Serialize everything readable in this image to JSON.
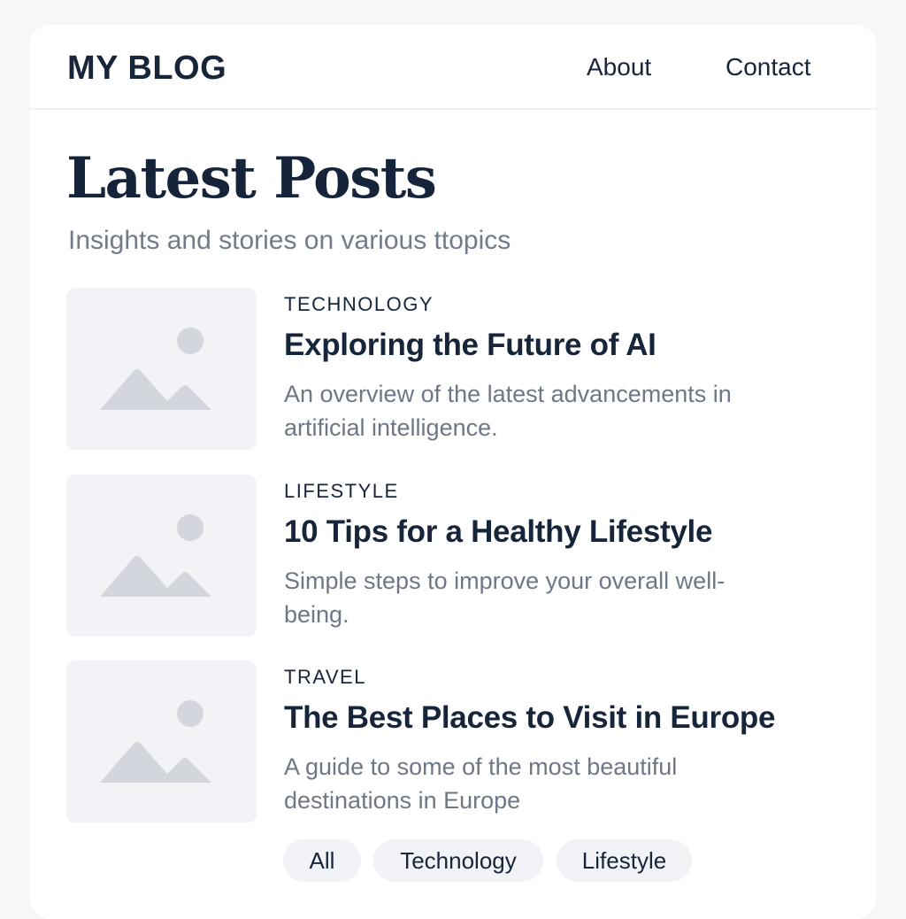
{
  "header": {
    "logo": "MY BLOG",
    "nav": [
      "About",
      "Contact"
    ]
  },
  "main": {
    "title": "Latest Posts",
    "subtitle": "Insights and stories on various ttopics",
    "posts": [
      {
        "category": "TECHNOLOGY",
        "title": "Exploring the Future of AI",
        "description": "An overview of the latest advancements in artificial intelligence.",
        "thumbnail_icon": "image-placeholder-icon"
      },
      {
        "category": "LIFESTYLE",
        "title": "10 Tips for a Healthy Lifestyle",
        "description": "Simple steps to improve your overall well-being.",
        "thumbnail_icon": "image-placeholder-icon"
      },
      {
        "category": "TRAVEL",
        "title": "The Best Places to Visit in Europe",
        "description": "A guide to some of the most beautiful destinations in Europe",
        "thumbnail_icon": "image-placeholder-icon"
      }
    ],
    "filters": [
      "All",
      "Technology",
      "Lifestyle"
    ]
  },
  "colors": {
    "background": "#f6f7f9",
    "card": "#ffffff",
    "text_primary": "#17253b",
    "text_secondary": "#6e7786",
    "placeholder_bg": "#f1f3f6",
    "placeholder_icon": "#d3d7dd"
  }
}
